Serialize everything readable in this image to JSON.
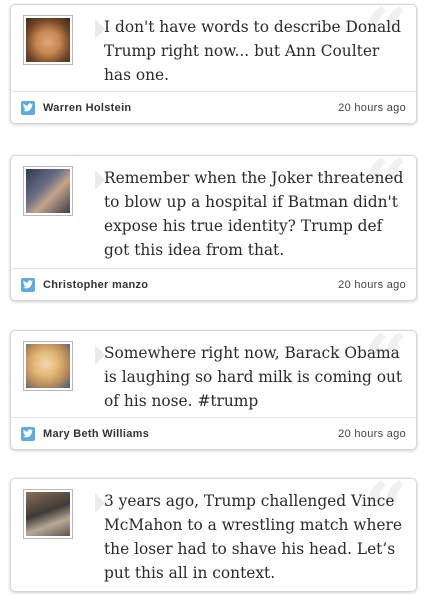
{
  "tweets": [
    {
      "text": "I don't have words to describe Donald Trump right now... but Ann Coulter has one.",
      "author": "Warren Holstein",
      "time": "20 hours ago"
    },
    {
      "text": "Remember when the Joker threatened to blow up a hospital if Batman didn't expose his true identity? Trump def got this idea from that.",
      "author": "Christopher manzo",
      "time": "20 hours ago"
    },
    {
      "text": "Somewhere right now, Barack Obama is laughing so hard milk is coming out of his nose. #trump",
      "author": "Mary Beth Williams",
      "time": "20 hours ago"
    },
    {
      "text": "3 years ago, Trump challenged Vince McMahon to a wrestling match where the loser had to shave his head. Let’s put this all in context.",
      "author": "",
      "time": ""
    }
  ],
  "quote_glyph": "“",
  "icons": {
    "source": "twitter-bird-icon",
    "background": "quote-mark-icon"
  },
  "colors": {
    "twitter_blue": "#5ea9dd",
    "card_border": "#d6d6d6",
    "text": "#2a2a2a",
    "quote_watermark": "#f0f0f0"
  }
}
